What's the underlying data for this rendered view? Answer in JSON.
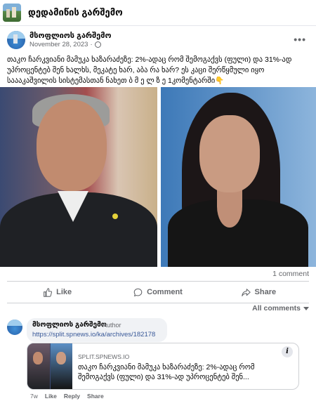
{
  "group": {
    "name": "დედამიწის გარშემო"
  },
  "post": {
    "author": "მსოფლიოს გარშემო",
    "date": "November 28, 2023",
    "date_suffix": "·",
    "more": "•••",
    "text": "თაკო ჩარკვიანი მამუკა ხაზარაძეზე: 2%-ადაც რომ შემოგაქვს (ფული) და 31%-ად უპროცენტებ შენ ხალხს, მეკატე ხარ, აბა რა ხარ? ეს კაცი შერწყმული იყო საააკაშვილის სისტემასთან ნახეთ  ბ მ ე ლ ზ ე   1კომენტარში👇"
  },
  "stats": {
    "comments": "1 comment"
  },
  "actions": {
    "like": "Like",
    "comment": "Comment",
    "share": "Share"
  },
  "comments_filter": "All comments",
  "comment": {
    "author": "მსოფლიოს გარშემო",
    "badge": "Author",
    "link": "https://split.spnews.io/ka/archives/182178",
    "preview": {
      "domain": "SPLIT.SPNEWS.IO",
      "title": "თაკო ჩარკვიანი მამუკა ხაზარაძეზე: 2%-ადაც რომ შემოგაქვს (ფული) და 31%-ად უპროცენტებ შენ..."
    },
    "time": "7w",
    "like": "Like",
    "reply": "Reply",
    "share": "Share"
  }
}
